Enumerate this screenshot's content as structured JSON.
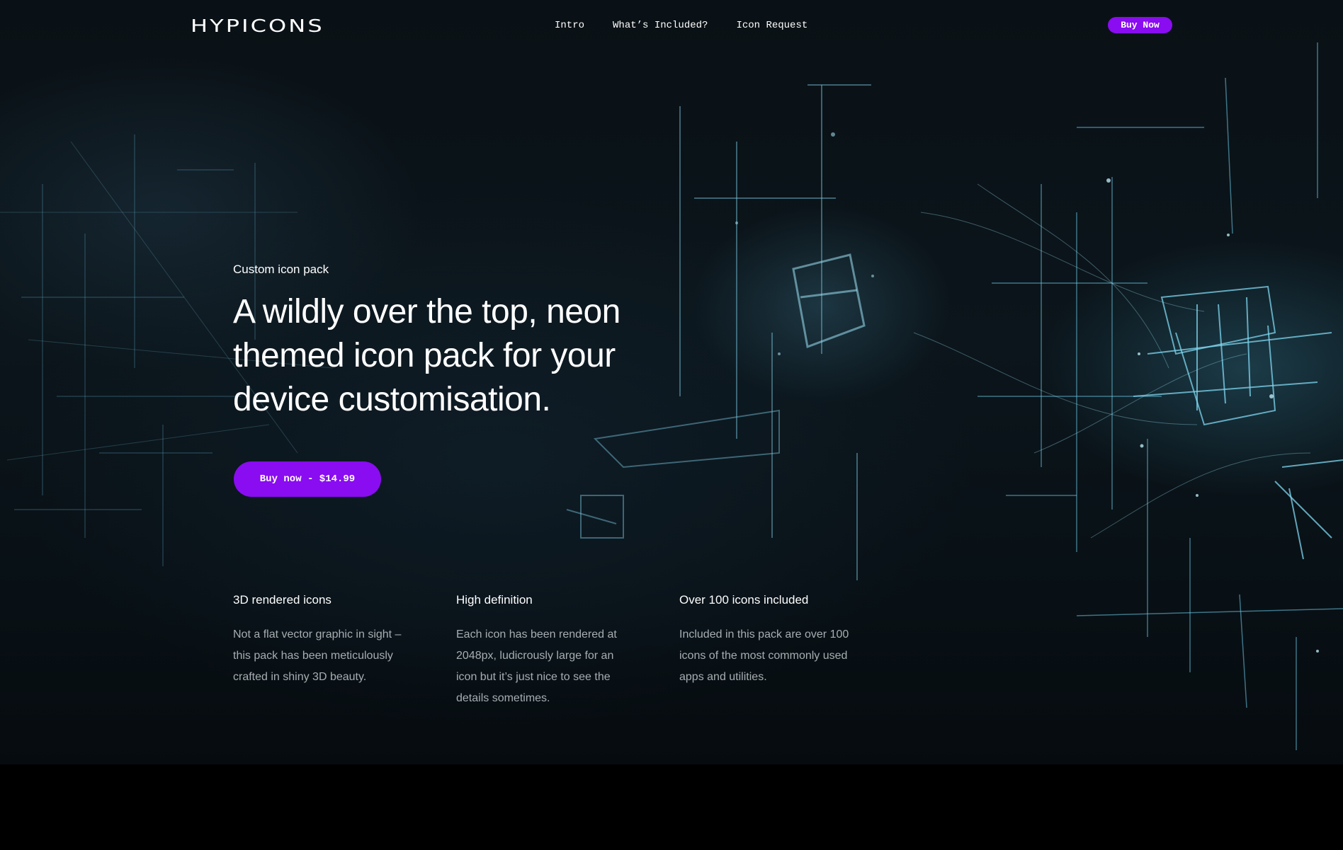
{
  "brand": {
    "logo_text": "HYPICONS"
  },
  "nav": {
    "links": [
      "Intro",
      "What’s Included?",
      "Icon Request"
    ],
    "buy_label": "Buy Now"
  },
  "hero": {
    "eyebrow": "Custom icon pack",
    "headline": "A wildly over the top, neon themed icon pack for your device customisation.",
    "cta_label": "Buy now - $14.99",
    "background": "dark-teal-neon-circuit-network"
  },
  "features": [
    {
      "title": "3D rendered icons",
      "description": "Not a flat vector graphic in sight – this pack has been meticulously crafted in shiny 3D beauty."
    },
    {
      "title": "High definition",
      "description": "Each icon has been rendered at 2048px, ludicrously large for an icon but it’s just nice to see the details sometimes."
    },
    {
      "title": "Over 100 icons included",
      "description": "Included in this pack are over 100 icons of the most commonly used apps and utilities."
    }
  ],
  "colors": {
    "accent": "#8a0cf0",
    "background": "#000000",
    "hero_teal": "#6fc8e0",
    "text_primary": "#ffffff",
    "text_secondary": "#a7aeb2"
  }
}
